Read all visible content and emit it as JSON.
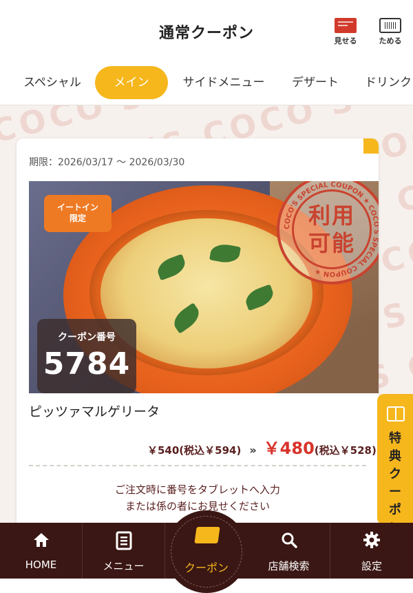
{
  "header": {
    "title": "通常クーポン",
    "show_label": "見せる",
    "save_label": "ためる"
  },
  "tabs": [
    {
      "label": "スペシャル"
    },
    {
      "label": "メイン",
      "active": true
    },
    {
      "label": "サイドメニュー"
    },
    {
      "label": "デザート"
    },
    {
      "label": "ドリンク"
    }
  ],
  "background_logo": "COCO'S",
  "coupon": {
    "period": "期限：2026/03/17 〜 2026/03/30",
    "eatin_badge_line1": "イートイン",
    "eatin_badge_line2": "限定",
    "stamp_text_line1": "利用",
    "stamp_text_line2": "可能",
    "stamp_ring_text": "COCO'S SPECIAL COUPON ★ COCO'S SPECIAL COUPON ★",
    "number_label": "クーポン番号",
    "number": "5784",
    "product_name": "ピッツァマルゲリータ",
    "old_price": "￥540(税込￥594)",
    "arrow": "»",
    "new_price": "￥480",
    "new_price_tax": "(税込￥528)",
    "instruction_line1": "ご注文時に番号をタブレットへ入力",
    "instruction_line2": "または係の者にお見せください"
  },
  "side_tab": {
    "label": "特典クーポン"
  },
  "bottom_nav": [
    {
      "label": "HOME",
      "icon": "home-icon"
    },
    {
      "label": "メニュー",
      "icon": "menu-icon"
    },
    {
      "label": "クーポン",
      "icon": "coupon-icon",
      "active": true
    },
    {
      "label": "店舗検索",
      "icon": "search-icon"
    },
    {
      "label": "設定",
      "icon": "gear-icon"
    }
  ],
  "colors": {
    "accent": "#f6b71d",
    "nav_bg": "#3a1714",
    "price_red": "#d8332a",
    "stamp_red": "#c9432f"
  }
}
